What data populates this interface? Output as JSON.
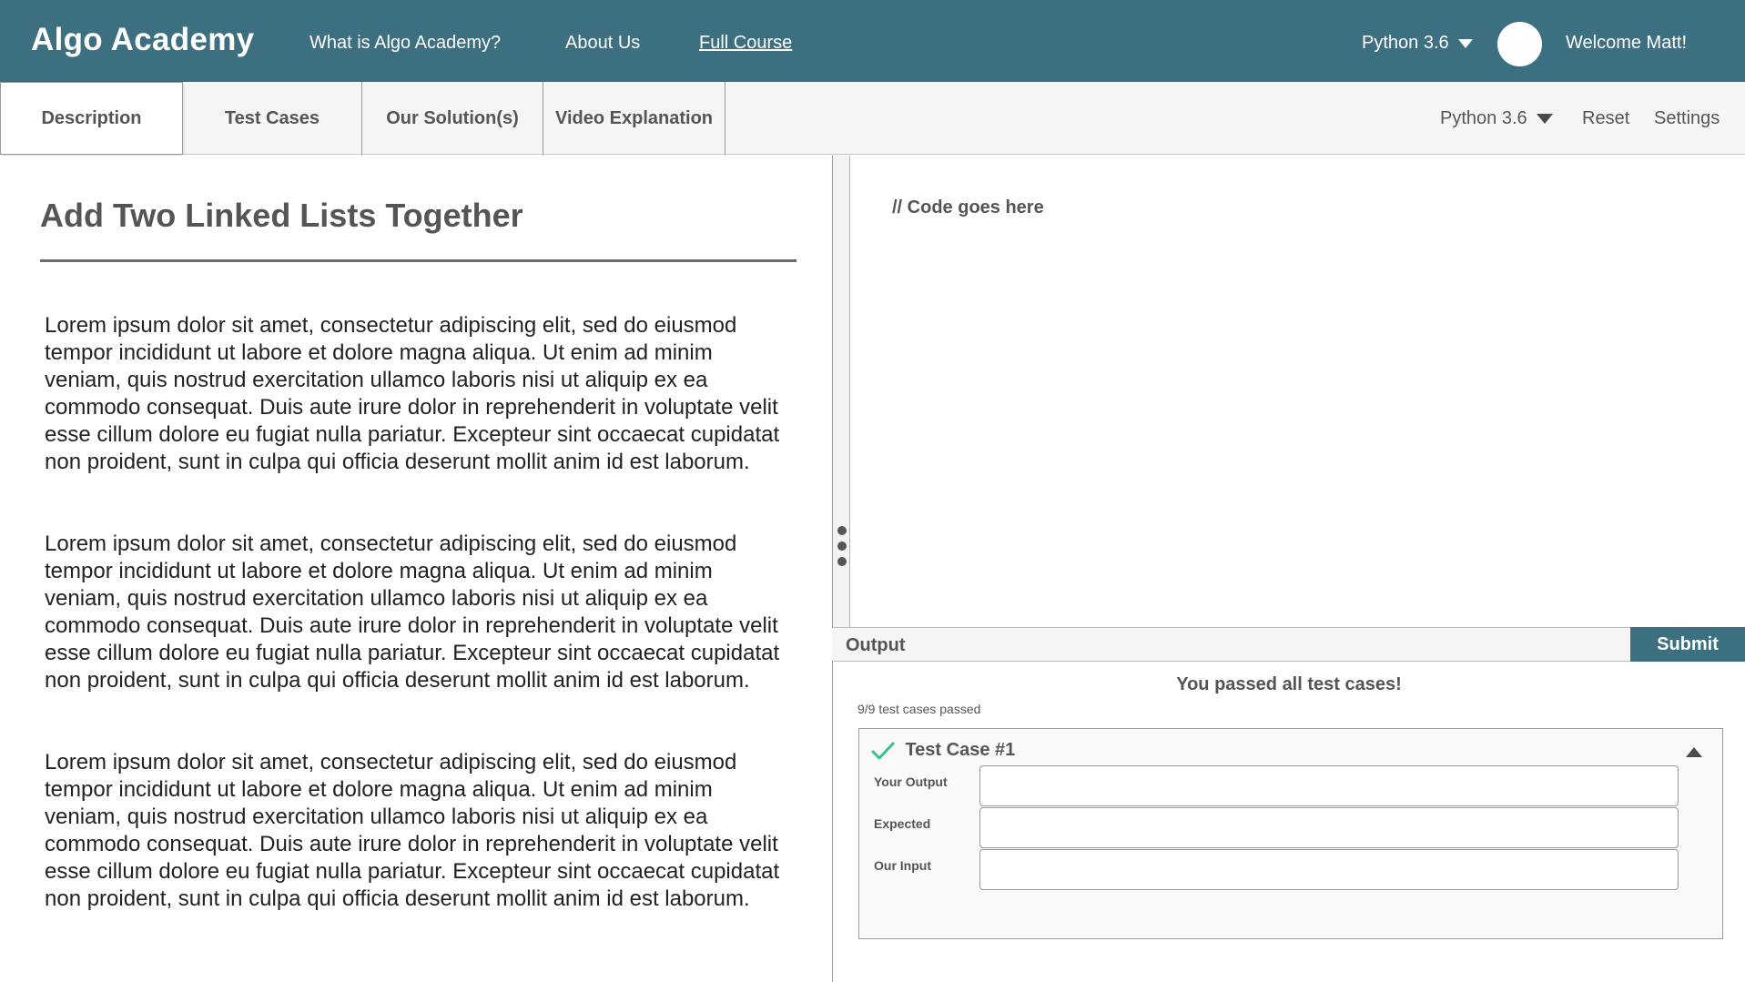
{
  "header": {
    "brand": "Algo Academy",
    "nav": [
      "What is Algo Academy?",
      "About Us",
      "Full Course"
    ],
    "language": "Python 3.6",
    "welcome": "Welcome Matt!"
  },
  "toolbar": {
    "tabs": [
      "Description",
      "Test Cases",
      "Our Solution(s)",
      "Video Explanation"
    ],
    "active_tab": "Description",
    "language": "Python 3.6",
    "reset_label": "Reset",
    "settings_label": "Settings"
  },
  "problem": {
    "title": "Add Two Linked Lists Together",
    "paragraphs": [
      "Lorem ipsum dolor sit amet, consectetur adipiscing elit, sed do eiusmod tempor incididunt ut labore et dolore magna aliqua. Ut enim ad minim veniam, quis nostrud exercitation ullamco laboris nisi ut aliquip ex ea commodo consequat. Duis aute irure dolor in reprehenderit in voluptate velit esse cillum dolore eu fugiat nulla pariatur. Excepteur sint occaecat cupidatat non proident, sunt in culpa qui officia deserunt mollit anim id est laborum.",
      "Lorem ipsum dolor sit amet, consectetur adipiscing elit, sed do eiusmod tempor incididunt ut labore et dolore magna aliqua. Ut enim ad minim veniam, quis nostrud exercitation ullamco laboris nisi ut aliquip ex ea commodo consequat. Duis aute irure dolor in reprehenderit in voluptate velit esse cillum dolore eu fugiat nulla pariatur. Excepteur sint occaecat cupidatat non proident, sunt in culpa qui officia deserunt mollit anim id est laborum.",
      "Lorem ipsum dolor sit amet, consectetur adipiscing elit, sed do eiusmod tempor incididunt ut labore et dolore magna aliqua. Ut enim ad minim veniam, quis nostrud exercitation ullamco laboris nisi ut aliquip ex ea commodo consequat. Duis aute irure dolor in reprehenderit in voluptate velit esse cillum dolore eu fugiat nulla pariatur. Excepteur sint occaecat cupidatat non proident, sunt in culpa qui officia deserunt mollit anim id est laborum."
    ]
  },
  "editor": {
    "placeholder": "// Code goes here"
  },
  "output": {
    "label": "Output",
    "submit_label": "Submit",
    "message": "You passed all test cases!",
    "count": "9/9 test cases passed",
    "test_case": {
      "title": "Test Case #1",
      "status": "passed",
      "fields": [
        {
          "label": "Your Output",
          "value": ""
        },
        {
          "label": "Expected",
          "value": ""
        },
        {
          "label": "Our Input",
          "value": ""
        }
      ]
    }
  },
  "icons": {
    "dropdown": "chevron-down-icon",
    "check": "check-icon",
    "collapse": "chevron-up-icon",
    "grip": "drag-handle-icon",
    "avatar": "avatar"
  },
  "colors": {
    "brand": "#3c7081",
    "success": "#3bbf8f",
    "text": "#555555",
    "toolbar_bg": "#f5f5f5"
  }
}
